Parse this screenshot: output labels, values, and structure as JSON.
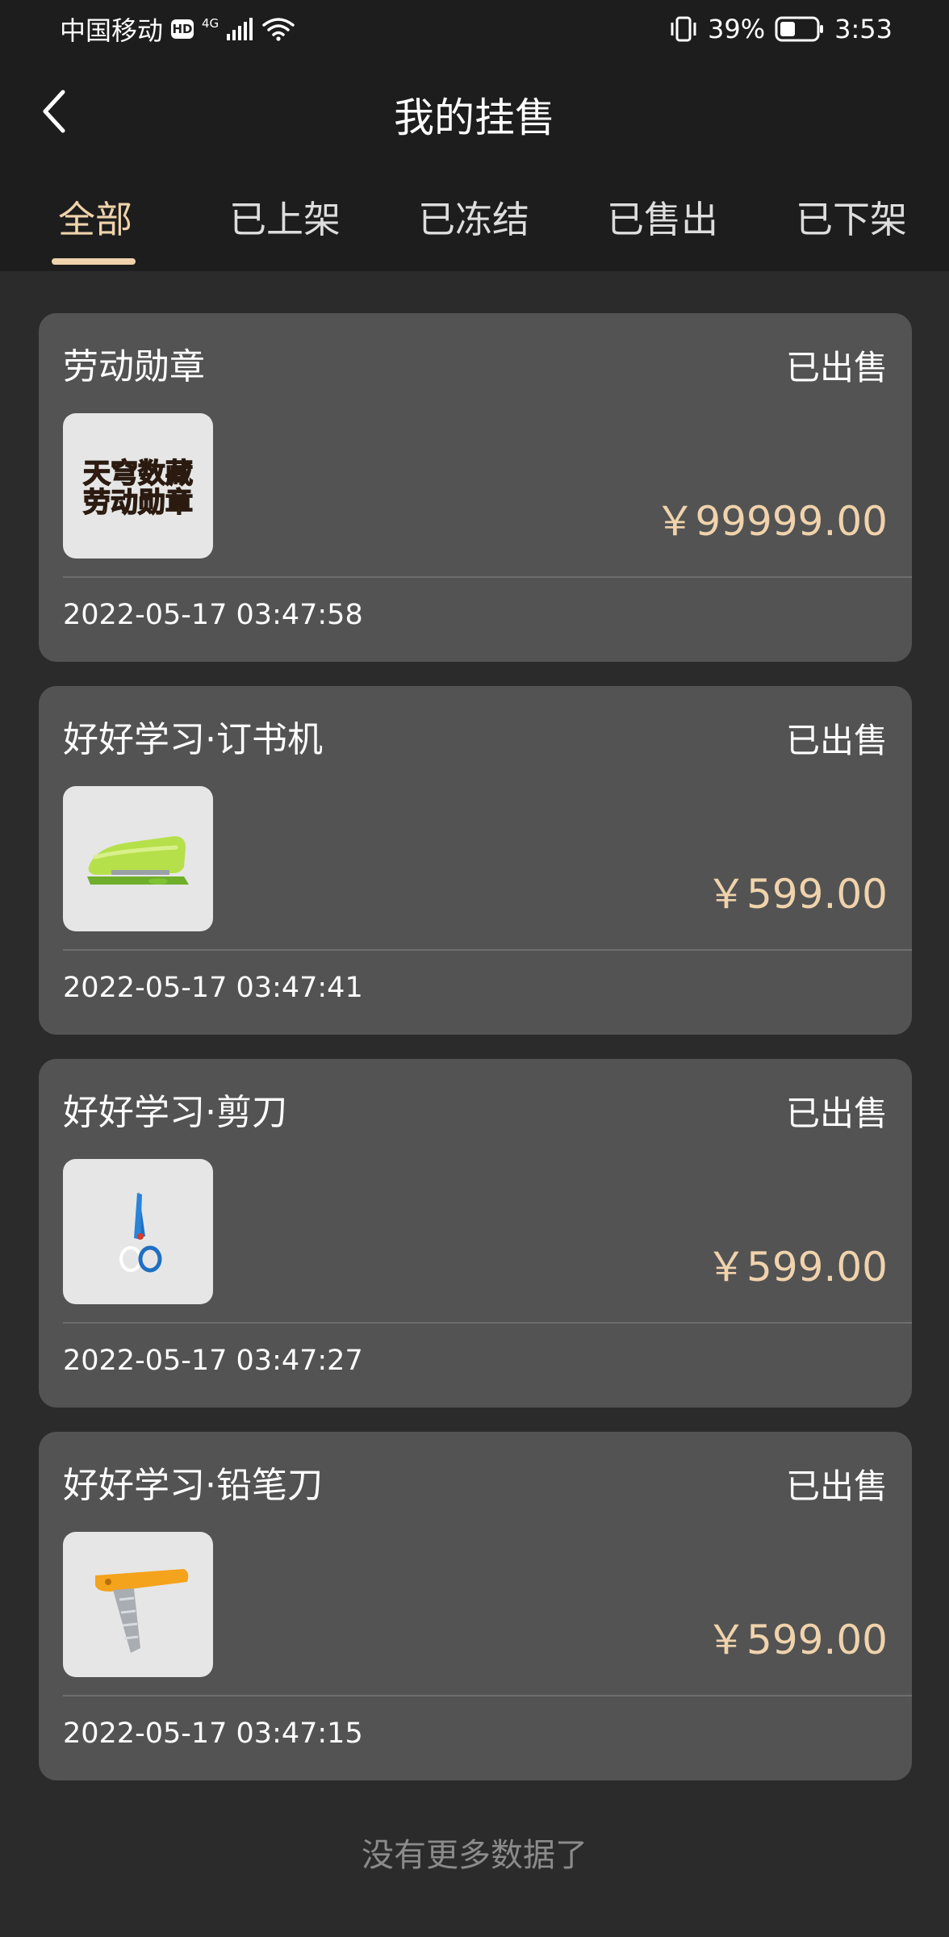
{
  "status_bar": {
    "carrier": "中国移动",
    "hd_badge": "HD",
    "network_type": "4G",
    "battery_percent": "39%",
    "time": "3:53"
  },
  "header": {
    "title": "我的挂售",
    "back_icon": "chevron-left-icon"
  },
  "tabs": [
    {
      "label": "全部",
      "active": true
    },
    {
      "label": "已上架",
      "active": false
    },
    {
      "label": "已冻结",
      "active": false
    },
    {
      "label": "已售出",
      "active": false
    },
    {
      "label": "已下架",
      "active": false
    }
  ],
  "listings": [
    {
      "name": "劳动勋章",
      "status": "已出售",
      "price": "￥99999.00",
      "time": "2022-05-17 03:47:58",
      "thumb_text_line1": "天穹数藏",
      "thumb_text_line2": "劳动勋章"
    },
    {
      "name": "好好学习·订书机",
      "status": "已出售",
      "price": "￥599.00",
      "time": "2022-05-17 03:47:41"
    },
    {
      "name": "好好学习·剪刀",
      "status": "已出售",
      "price": "￥599.00",
      "time": "2022-05-17 03:47:27"
    },
    {
      "name": "好好学习·铅笔刀",
      "status": "已出售",
      "price": "￥599.00",
      "time": "2022-05-17 03:47:15"
    }
  ],
  "footer": {
    "no_more_text": "没有更多数据了"
  },
  "colors": {
    "accent": "#f0d3ac",
    "card_bg": "#535353",
    "page_bg": "#2b2b2b",
    "header_bg": "#1d1d1d"
  }
}
